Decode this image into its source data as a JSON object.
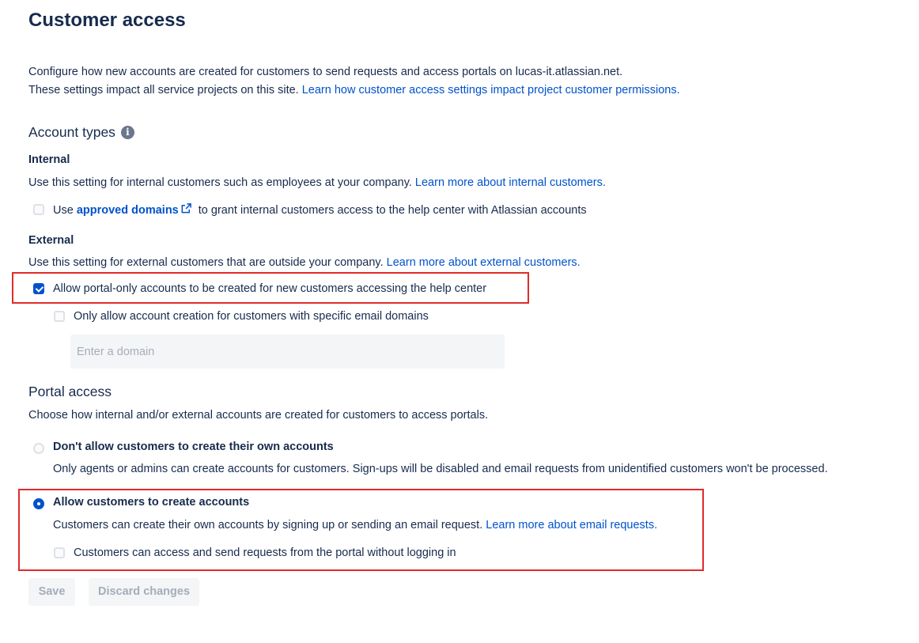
{
  "page": {
    "title": "Customer access",
    "description_line1": "Configure how new accounts are created for customers to send requests and access portals on lucas-it.atlassian.net.",
    "description_line2": "These settings impact all service projects on this site. ",
    "description_link": "Learn how customer access settings impact project customer permissions."
  },
  "account_types": {
    "heading": "Account types",
    "info_icon": "info-icon",
    "internal": {
      "heading": "Internal",
      "text": "Use this setting for internal customers such as employees at your company. ",
      "link": "Learn more about internal customers.",
      "checkbox": {
        "checked": false,
        "label_before": "Use ",
        "label_link": "approved domains",
        "label_after": " to grant internal customers access to the help center with Atlassian accounts",
        "icon": "external-link-icon"
      }
    },
    "external": {
      "heading": "External",
      "text": "Use this setting for external customers that are outside your company. ",
      "link": "Learn more about external customers.",
      "checkbox_portal_only": {
        "checked": true,
        "label": "Allow portal-only accounts to be created for new customers accessing the help center"
      },
      "checkbox_specific_domains": {
        "checked": false,
        "label": "Only allow account creation for customers with specific email domains"
      },
      "domain_input": {
        "value": "",
        "placeholder": "Enter a domain"
      }
    }
  },
  "portal_access": {
    "heading": "Portal access",
    "text": "Choose how internal and/or external accounts are created for customers to access portals.",
    "option_dont_allow": {
      "selected": false,
      "label": "Don't allow customers to create their own accounts",
      "description": "Only agents or admins can create accounts for customers. Sign-ups will be disabled and email requests from unidentified customers won't be processed."
    },
    "option_allow": {
      "selected": true,
      "label": "Allow customers to create accounts",
      "description": "Customers can create their own accounts by signing up or sending an email request. ",
      "link": "Learn more about email requests.",
      "checkbox_no_login": {
        "checked": false,
        "label": "Customers can access and send requests from the portal without logging in"
      }
    }
  },
  "actions": {
    "save_label": "Save",
    "discard_label": "Discard changes"
  },
  "colors": {
    "text": "#172b4d",
    "link": "#0052cc",
    "highlight": "#e02b2b",
    "disabled_text": "#a5adba"
  }
}
